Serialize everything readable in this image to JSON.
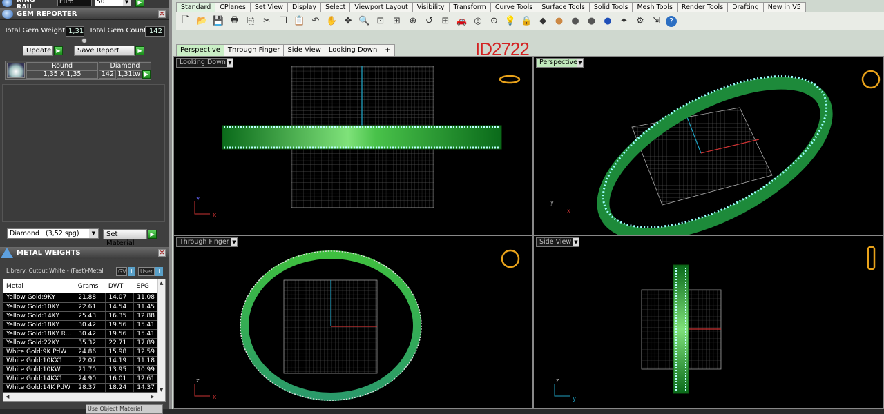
{
  "ring_rail": {
    "title": "RING RAIL",
    "currency": "Euro",
    "qty": "50"
  },
  "gem_reporter": {
    "title": "GEM REPORTER",
    "total_weight_label": "Total Gem Weight",
    "total_weight": "1,31",
    "total_count_label": "Total Gem Count",
    "total_count": "142",
    "update_label": "Update",
    "save_label": "Save Report",
    "col_shape": "Round",
    "col_type": "Diamond",
    "row_size": "1,35 X 1,35",
    "row_count": "142",
    "row_weight": "1,31tw",
    "material_select": "Diamond   (3,52 spg)",
    "set_material_label": "Set Material"
  },
  "metal_weights": {
    "title": "METAL WEIGHTS",
    "library": "Library: Cutout White - (Fast)-Metal",
    "gv_label": "GV",
    "user_label": "User",
    "headers": [
      "Metal",
      "Grams",
      "DWT",
      "SPG"
    ],
    "rows": [
      [
        "Yellow Gold:9KY",
        "21.88",
        "14.07",
        "11.08"
      ],
      [
        "Yellow Gold:10KY",
        "22.61",
        "14.54",
        "11.45"
      ],
      [
        "Yellow Gold:14KY",
        "25.43",
        "16.35",
        "12.88"
      ],
      [
        "Yellow Gold:18KY",
        "30.42",
        "19.56",
        "15.41"
      ],
      [
        "Yellow Gold:18KY R...",
        "30.42",
        "19.56",
        "15.41"
      ],
      [
        "Yellow Gold:22KY",
        "35.32",
        "22.71",
        "17.89"
      ],
      [
        "White Gold:9K PdW",
        "24.86",
        "15.98",
        "12.59"
      ],
      [
        "White Gold:10KX1",
        "22.07",
        "14.19",
        "11.18"
      ],
      [
        "White Gold:10KW",
        "21.70",
        "13.95",
        "10.99"
      ],
      [
        "White Gold:14KX1",
        "24.90",
        "16.01",
        "12.61"
      ],
      [
        "White Gold:14K PdW",
        "28.37",
        "18.24",
        "14.37"
      ]
    ],
    "footer_select": "Use Object Material"
  },
  "toolbar_tabs": [
    "Standard",
    "CPlanes",
    "Set View",
    "Display",
    "Select",
    "Viewport Layout",
    "Visibility",
    "Transform",
    "Curve Tools",
    "Surface Tools",
    "Solid Tools",
    "Mesh Tools",
    "Render Tools",
    "Drafting",
    "New in V5"
  ],
  "toolbar_icons": [
    "new-icon",
    "open-icon",
    "save-icon",
    "print-icon",
    "import-icon",
    "cut-icon",
    "copy-icon",
    "paste-icon",
    "undo-icon",
    "pan-icon",
    "rotate-icon",
    "zoom-icon",
    "zoom-window-icon",
    "zoom-extents-icon",
    "zoom-selected-icon",
    "undo-view-icon",
    "viewport-4-icon",
    "car-icon",
    "analyze-icon",
    "point-icon",
    "light-icon",
    "lock-icon",
    "material-icon",
    "color-wheel-icon",
    "render-sphere-icon",
    "shaded-sphere-icon",
    "blue-sphere-icon",
    "wand-icon",
    "gear-icon",
    "distribute-icon",
    "help-icon"
  ],
  "viewport_tabs": [
    "Perspective",
    "Through Finger",
    "Side View",
    "Looking Down",
    "+"
  ],
  "watermark": "ID2722",
  "viewports": {
    "looking_down": "Looking Down",
    "perspective": "Perspective",
    "through_finger": "Through Finger",
    "side_view": "Side View"
  },
  "axes": {
    "looking_down": [
      "y",
      "x"
    ],
    "perspective": [
      "y",
      "x"
    ],
    "through_finger": [
      "z",
      "x"
    ],
    "side_view": [
      "z",
      "y"
    ]
  }
}
